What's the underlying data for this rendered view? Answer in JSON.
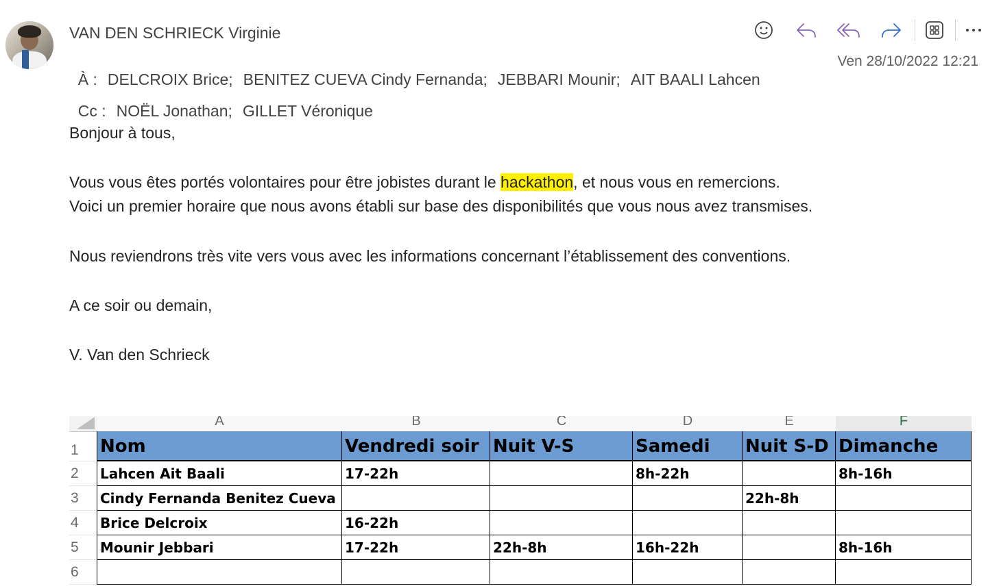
{
  "email": {
    "sender": "VAN DEN SCHRIECK Virginie",
    "to_label": "À :",
    "to": [
      "DELCROIX Brice;",
      "BENITEZ CUEVA Cindy Fernanda;",
      "JEBBARI Mounir;",
      "AIT BAALI Lahcen"
    ],
    "cc_label": "Cc :",
    "cc": [
      "NOËL Jonathan;",
      "GILLET Véronique"
    ],
    "date": "Ven 28/10/2022 12:21",
    "actions": [
      "emoji-icon",
      "reply-icon",
      "reply-all-icon",
      "forward-icon",
      "apps-icon",
      "more-icon"
    ],
    "accent_color": "#8764b8"
  },
  "body": {
    "greeting": "Bonjour à tous,",
    "line1_before": "Vous vous êtes portés volontaires pour être jobistes durant le ",
    "line1_highlight": "hackathon",
    "line1_after": ", et nous vous en remercions.",
    "line2": "Voici un premier horaire que nous avons établi sur base des disponibilités que vous nous avez transmises.",
    "line3": "Nous reviendrons très vite vers vous avec les informations concernant l’établissement des conventions.",
    "line4": "A ce soir ou demain,",
    "signature": "V. Van den Schrieck",
    "highlight_color": "#fff100"
  },
  "sheet": {
    "col_letters": [
      "A",
      "B",
      "C",
      "D",
      "E",
      "F"
    ],
    "row_numbers": [
      "1",
      "2",
      "3",
      "4",
      "5",
      "6"
    ],
    "header_fill": "#6b9bd1",
    "headers": [
      "Nom",
      "Vendredi soir",
      "Nuit V-S",
      "Samedi",
      "Nuit S-D",
      "Dimanche"
    ],
    "rows": [
      [
        "Lahcen Ait Baali",
        "17-22h",
        "",
        "8h-22h",
        "",
        "8h-16h"
      ],
      [
        "Cindy Fernanda Benitez Cueva",
        "",
        "",
        "",
        "22h-8h",
        ""
      ],
      [
        "Brice Delcroix",
        "16-22h",
        "",
        "",
        "",
        ""
      ],
      [
        "Mounir Jebbari",
        "17-22h",
        "22h-8h",
        "16h-22h",
        "",
        "8h-16h"
      ],
      [
        "",
        "",
        "",
        "",
        "",
        ""
      ]
    ]
  }
}
